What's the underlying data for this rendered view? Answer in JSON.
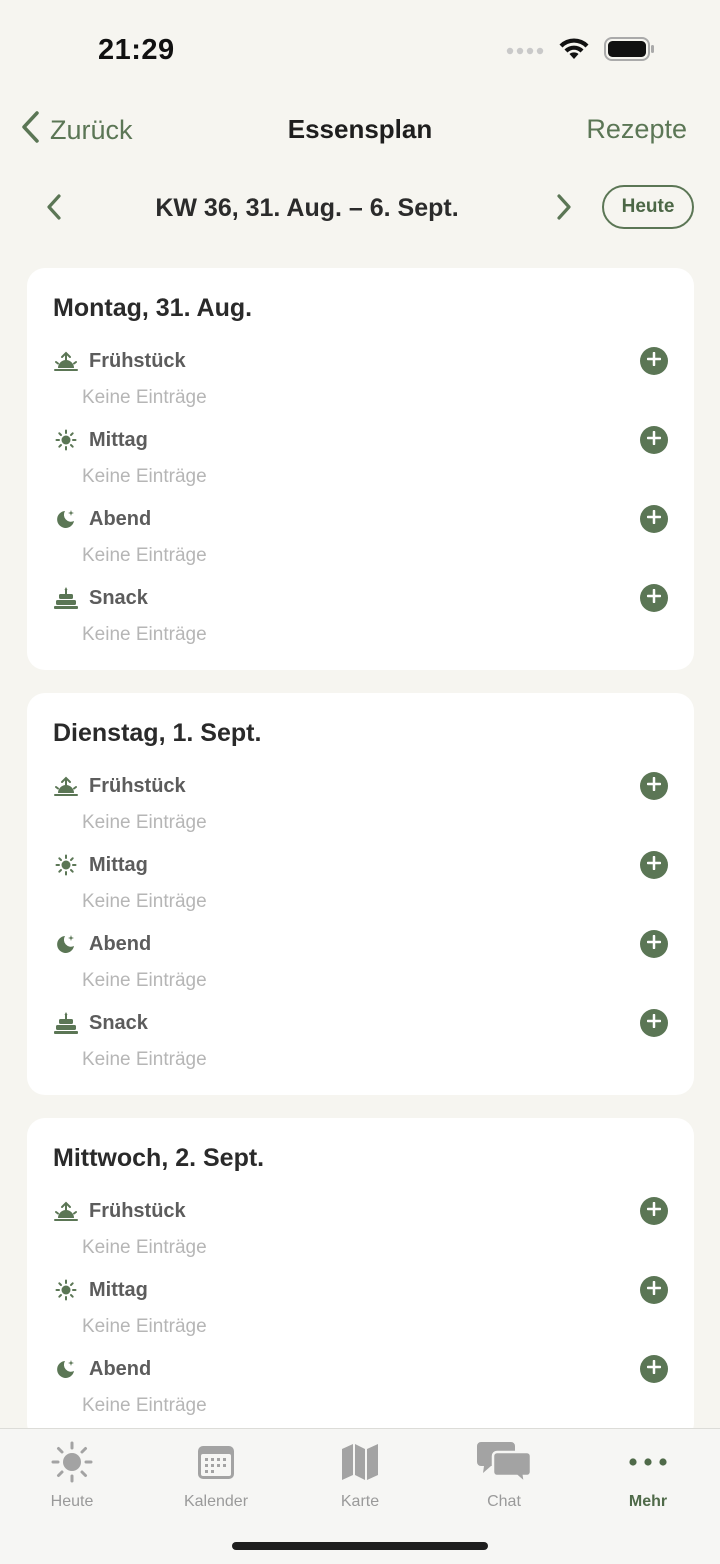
{
  "status_bar": {
    "time": "21:29"
  },
  "nav": {
    "back_label": "Zurück",
    "title": "Essensplan",
    "right_label": "Rezepte"
  },
  "week": {
    "label": "KW 36, 31. Aug. – 6. Sept.",
    "today_label": "Heute"
  },
  "colors": {
    "accent": "#5b7655",
    "background": "#f6f5f0",
    "card": "#ffffff",
    "muted": "#b6b6b6"
  },
  "days": [
    {
      "title": "Montag, 31. Aug.",
      "meals": [
        {
          "name": "Frühstück",
          "icon": "sunrise-icon",
          "empty": "Keine Einträge"
        },
        {
          "name": "Mittag",
          "icon": "sun-icon",
          "empty": "Keine Einträge"
        },
        {
          "name": "Abend",
          "icon": "moon-icon",
          "empty": "Keine Einträge"
        },
        {
          "name": "Snack",
          "icon": "cake-icon",
          "empty": "Keine Einträge"
        }
      ]
    },
    {
      "title": "Dienstag, 1. Sept.",
      "meals": [
        {
          "name": "Frühstück",
          "icon": "sunrise-icon",
          "empty": "Keine Einträge"
        },
        {
          "name": "Mittag",
          "icon": "sun-icon",
          "empty": "Keine Einträge"
        },
        {
          "name": "Abend",
          "icon": "moon-icon",
          "empty": "Keine Einträge"
        },
        {
          "name": "Snack",
          "icon": "cake-icon",
          "empty": "Keine Einträge"
        }
      ]
    },
    {
      "title": "Mittwoch, 2. Sept.",
      "meals": [
        {
          "name": "Frühstück",
          "icon": "sunrise-icon",
          "empty": "Keine Einträge"
        },
        {
          "name": "Mittag",
          "icon": "sun-icon",
          "empty": "Keine Einträge"
        },
        {
          "name": "Abend",
          "icon": "moon-icon",
          "empty": "Keine Einträge"
        }
      ]
    }
  ],
  "tabs": [
    {
      "label": "Heute",
      "icon": "sun-icon",
      "active": false
    },
    {
      "label": "Kalender",
      "icon": "calendar-icon",
      "active": false
    },
    {
      "label": "Karte",
      "icon": "map-icon",
      "active": false
    },
    {
      "label": "Chat",
      "icon": "chat-bubbles-icon",
      "active": false
    },
    {
      "label": "Mehr",
      "icon": "more-dots-icon",
      "active": true
    }
  ]
}
